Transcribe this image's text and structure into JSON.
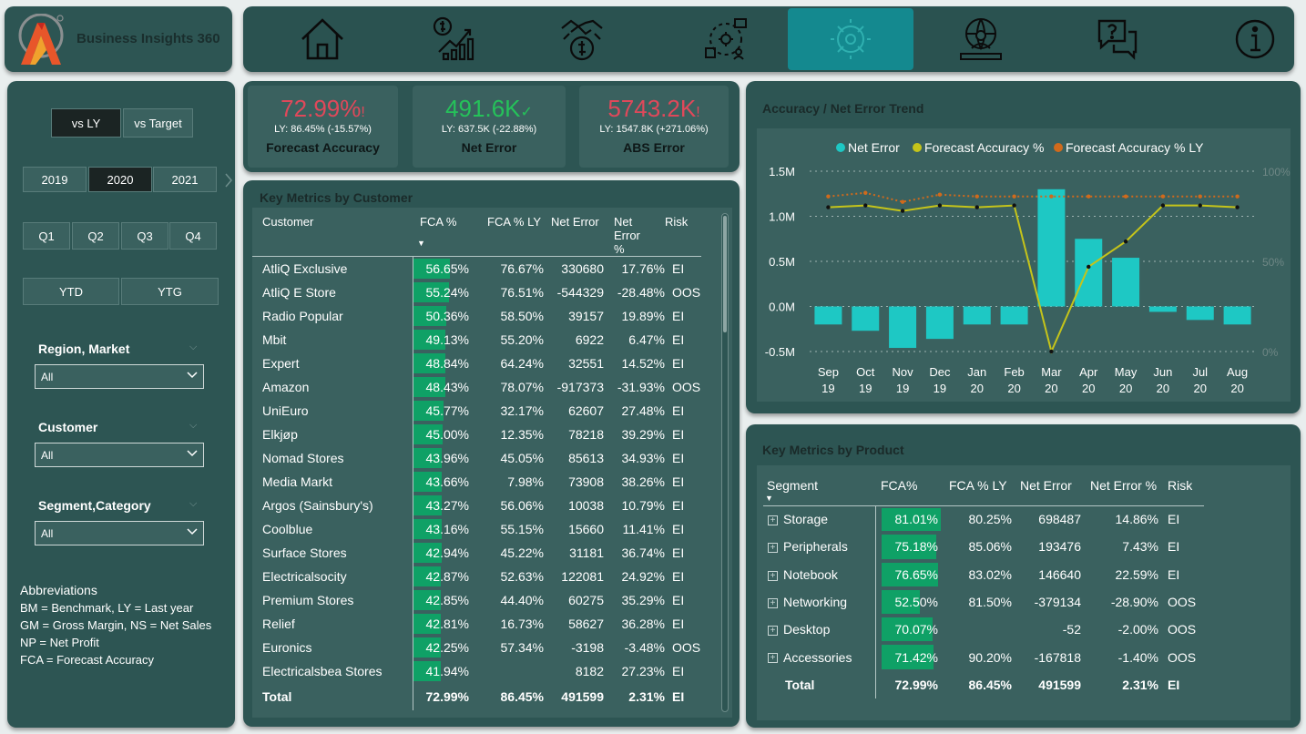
{
  "app": {
    "logo_text": "Business Insights 360"
  },
  "nav": {
    "items": [
      {
        "icon": "home-icon"
      },
      {
        "icon": "finance-icon"
      },
      {
        "icon": "sales-icon"
      },
      {
        "icon": "supply-chain-icon"
      },
      {
        "icon": "forecast-accuracy-icon",
        "active": true
      },
      {
        "icon": "executive-icon"
      },
      {
        "icon": "support-icon"
      },
      {
        "icon": "info-icon"
      }
    ]
  },
  "filters": {
    "compare": [
      "vs LY",
      "vs Target"
    ],
    "years": [
      "2019",
      "2020",
      "2021"
    ],
    "quarters": [
      "Q1",
      "Q2",
      "Q3",
      "Q4"
    ],
    "period": [
      "YTD",
      "YTG"
    ],
    "region": {
      "title": "Region, Market",
      "value": "All"
    },
    "customer": {
      "title": "Customer",
      "value": "All"
    },
    "segment": {
      "title": "Segment,Category",
      "value": "All"
    },
    "abbreviations": {
      "title": "Abbreviations",
      "lines": [
        "BM = Benchmark, LY = Last year",
        "GM = Gross Margin, NS = Net Sales",
        "NP = Net Profit",
        "FCA = Forecast Accuracy"
      ]
    }
  },
  "kpis": [
    {
      "value": "72.99%",
      "mark": "!",
      "ly": "LY: 86.45% (-15.57%)",
      "label": "Forecast Accuracy",
      "color": "#e0485a"
    },
    {
      "value": "491.6K",
      "mark": "✓",
      "ly": "LY: 637.5K (-22.88%)",
      "label": "Net Error",
      "color": "#25c25a"
    },
    {
      "value": "5743.2K",
      "mark": "!",
      "ly": "LY: 1547.8K (+271.06%)",
      "label": "ABS Error",
      "color": "#e0485a"
    }
  ],
  "customer_table": {
    "title": "Key Metrics by Customer",
    "headers": [
      "Customer",
      "FCA %",
      "FCA % LY",
      "Net Error",
      "Net Error %",
      "Risk"
    ],
    "rows": [
      {
        "name": "AtliQ Exclusive",
        "fca": "56.65%",
        "fca_pct": 56.65,
        "fca_ly": "76.67%",
        "net_error": "330680",
        "net_error_pct": "17.76%",
        "risk": "EI"
      },
      {
        "name": "AtliQ E Store",
        "fca": "55.24%",
        "fca_pct": 55.24,
        "fca_ly": "76.51%",
        "net_error": "-544329",
        "net_error_pct": "-28.48%",
        "risk": "OOS"
      },
      {
        "name": "Radio Popular",
        "fca": "50.36%",
        "fca_pct": 50.36,
        "fca_ly": "58.50%",
        "net_error": "39157",
        "net_error_pct": "19.89%",
        "risk": "EI"
      },
      {
        "name": "Mbit",
        "fca": "49.13%",
        "fca_pct": 49.13,
        "fca_ly": "55.20%",
        "net_error": "6922",
        "net_error_pct": "6.47%",
        "risk": "EI"
      },
      {
        "name": "Expert",
        "fca": "48.84%",
        "fca_pct": 48.84,
        "fca_ly": "64.24%",
        "net_error": "32551",
        "net_error_pct": "14.52%",
        "risk": "EI"
      },
      {
        "name": "Amazon",
        "fca": "48.43%",
        "fca_pct": 48.43,
        "fca_ly": "78.07%",
        "net_error": "-917373",
        "net_error_pct": "-31.93%",
        "risk": "OOS"
      },
      {
        "name": "UniEuro",
        "fca": "45.77%",
        "fca_pct": 45.77,
        "fca_ly": "32.17%",
        "net_error": "62607",
        "net_error_pct": "27.48%",
        "risk": "EI"
      },
      {
        "name": "Elkjøp",
        "fca": "45.00%",
        "fca_pct": 45.0,
        "fca_ly": "12.35%",
        "net_error": "78218",
        "net_error_pct": "39.29%",
        "risk": "EI"
      },
      {
        "name": "Nomad Stores",
        "fca": "43.96%",
        "fca_pct": 43.96,
        "fca_ly": "45.05%",
        "net_error": "85613",
        "net_error_pct": "34.93%",
        "risk": "EI"
      },
      {
        "name": "Media Markt",
        "fca": "43.66%",
        "fca_pct": 43.66,
        "fca_ly": "7.98%",
        "net_error": "73908",
        "net_error_pct": "38.26%",
        "risk": "EI"
      },
      {
        "name": "Argos (Sainsbury's)",
        "fca": "43.27%",
        "fca_pct": 43.27,
        "fca_ly": "56.06%",
        "net_error": "10038",
        "net_error_pct": "10.79%",
        "risk": "EI"
      },
      {
        "name": "Coolblue",
        "fca": "43.16%",
        "fca_pct": 43.16,
        "fca_ly": "55.15%",
        "net_error": "15660",
        "net_error_pct": "11.41%",
        "risk": "EI"
      },
      {
        "name": "Surface Stores",
        "fca": "42.94%",
        "fca_pct": 42.94,
        "fca_ly": "45.22%",
        "net_error": "31181",
        "net_error_pct": "36.74%",
        "risk": "EI"
      },
      {
        "name": "Electricalsocity",
        "fca": "42.87%",
        "fca_pct": 42.87,
        "fca_ly": "52.63%",
        "net_error": "122081",
        "net_error_pct": "24.92%",
        "risk": "EI"
      },
      {
        "name": "Premium Stores",
        "fca": "42.85%",
        "fca_pct": 42.85,
        "fca_ly": "44.40%",
        "net_error": "60275",
        "net_error_pct": "35.29%",
        "risk": "EI"
      },
      {
        "name": "Relief",
        "fca": "42.81%",
        "fca_pct": 42.81,
        "fca_ly": "16.73%",
        "net_error": "58627",
        "net_error_pct": "36.28%",
        "risk": "EI"
      },
      {
        "name": "Euronics",
        "fca": "42.25%",
        "fca_pct": 42.25,
        "fca_ly": "57.34%",
        "net_error": "-3198",
        "net_error_pct": "-3.48%",
        "risk": "OOS"
      },
      {
        "name": "Electricalsbea Stores",
        "fca": "41.94%",
        "fca_pct": 41.94,
        "fca_ly": "",
        "net_error": "8182",
        "net_error_pct": "27.23%",
        "risk": "EI"
      }
    ],
    "total": {
      "name": "Total",
      "fca": "72.99%",
      "fca_ly": "86.45%",
      "net_error": "491599",
      "net_error_pct": "2.31%",
      "risk": "EI"
    }
  },
  "trend": {
    "title": "Accuracy / Net Error Trend",
    "legend": [
      "Net Error",
      "Forecast Accuracy %",
      "Forecast Accuracy % LY"
    ],
    "colors": {
      "net_error": "#1ec8c4",
      "fca": "#c5c41a",
      "fca_ly": "#d06a1c"
    }
  },
  "chart_data": {
    "type": "bar",
    "title": "Accuracy / Net Error Trend",
    "categories": [
      "Sep 19",
      "Oct 19",
      "Nov 19",
      "Dec 19",
      "Jan 20",
      "Feb 20",
      "Mar 20",
      "Apr 20",
      "May 20",
      "Jun 20",
      "Jul 20",
      "Aug 20"
    ],
    "y_ticks": [
      "1.5M",
      "1.0M",
      "0.5M",
      "0.0M",
      "-0.5M"
    ],
    "ylim": [
      -0.5,
      1.5
    ],
    "y2_ticks": [
      "100%",
      "50%",
      "0%"
    ],
    "y2lim": [
      0,
      100
    ],
    "series": [
      {
        "name": "Net Error",
        "type": "bar",
        "values": [
          -0.2,
          -0.27,
          -0.46,
          -0.36,
          -0.2,
          -0.2,
          1.3,
          0.75,
          0.54,
          -0.06,
          -0.15,
          -0.2
        ]
      },
      {
        "name": "Forecast Accuracy %",
        "type": "line",
        "values": [
          80,
          81,
          78,
          81,
          80,
          81,
          0,
          47,
          61,
          81,
          81,
          80
        ]
      },
      {
        "name": "Forecast Accuracy % LY",
        "type": "line",
        "values": [
          86,
          88,
          83,
          87,
          86,
          86,
          86,
          86,
          86,
          86,
          86,
          86
        ]
      }
    ],
    "grid": true,
    "legend_position": "top"
  },
  "product_table": {
    "title": "Key Metrics by Product",
    "headers": [
      "Segment",
      "FCA%",
      "FCA % LY",
      "Net Error",
      "Net Error %",
      "Risk"
    ],
    "rows": [
      {
        "name": "Storage",
        "fca": "81.01%",
        "fca_pct": 81.01,
        "fca_ly": "80.25%",
        "net_error": "698487",
        "net_error_pct": "14.86%",
        "risk": "EI"
      },
      {
        "name": "Peripherals",
        "fca": "75.18%",
        "fca_pct": 75.18,
        "fca_ly": "85.06%",
        "net_error": "193476",
        "net_error_pct": "7.43%",
        "risk": "EI"
      },
      {
        "name": "Notebook",
        "fca": "76.65%",
        "fca_pct": 76.65,
        "fca_ly": "83.02%",
        "net_error": "146640",
        "net_error_pct": "22.59%",
        "risk": "EI"
      },
      {
        "name": "Networking",
        "fca": "52.50%",
        "fca_pct": 52.5,
        "fca_ly": "81.50%",
        "net_error": "-379134",
        "net_error_pct": "-28.90%",
        "risk": "OOS"
      },
      {
        "name": "Desktop",
        "fca": "70.07%",
        "fca_pct": 70.07,
        "fca_ly": "",
        "net_error": "-52",
        "net_error_pct": "-2.00%",
        "risk": "OOS"
      },
      {
        "name": "Accessories",
        "fca": "71.42%",
        "fca_pct": 71.42,
        "fca_ly": "90.20%",
        "net_error": "-167818",
        "net_error_pct": "-1.40%",
        "risk": "OOS"
      }
    ],
    "total": {
      "name": "Total",
      "fca": "72.99%",
      "fca_ly": "86.45%",
      "net_error": "491599",
      "net_error_pct": "2.31%",
      "risk": "EI"
    }
  }
}
